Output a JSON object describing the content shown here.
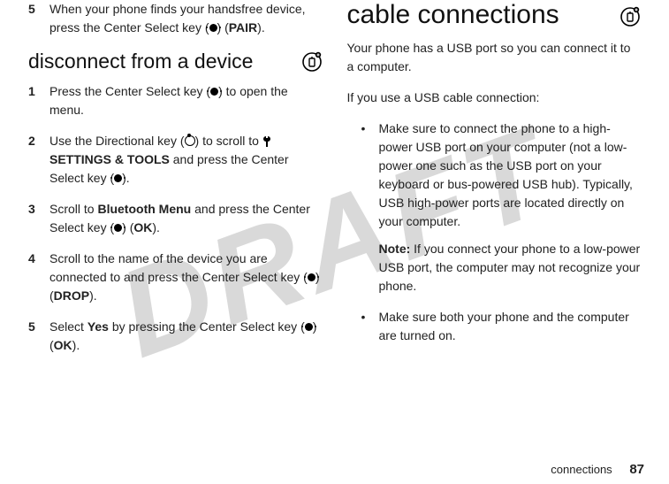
{
  "watermark": "DRAFT",
  "left": {
    "step5": {
      "num": "5",
      "text_a": "When your phone finds your handsfree device, press the Center Select key (",
      "text_b": ") (",
      "pair": "PAIR",
      "text_c": ")."
    },
    "h2": "disconnect from a device",
    "d1": {
      "num": "1",
      "a": "Press the Center Select key (",
      "b": ") to open the menu."
    },
    "d2": {
      "num": "2",
      "a": "Use the Directional key (",
      "b": ") to scroll to ",
      "menu": "SETTINGS & TOOLS",
      "c": " and press the Center Select key (",
      "d": ")."
    },
    "d3": {
      "num": "3",
      "a": "Scroll to ",
      "menu": "Bluetooth Menu",
      "b": " and press the Center Select key (",
      "c": ") (",
      "ok": "OK",
      "d": ")."
    },
    "d4": {
      "num": "4",
      "a": "Scroll to the name of the device you are connected to and press the Center Select key (",
      "b": ") (",
      "drop": "DROP",
      "c": ")."
    },
    "d5": {
      "num": "5",
      "a": "Select ",
      "yes": "Yes",
      "b": " by pressing the Center Select key (",
      "c": ") (",
      "ok": "OK",
      "d": ")."
    }
  },
  "right": {
    "h1": "cable connections",
    "p1": "Your phone has a USB port so you can connect it to a computer.",
    "p2": "If you use a USB cable connection:",
    "b1": "Make sure to connect the phone to a high-power USB port on your computer (not a low-power one such as the USB port on your keyboard or bus-powered USB hub). Typically, USB high-power ports are located directly on your computer.",
    "note_label": "Note:",
    "note_body": " If you connect your phone to a low-power USB port, the computer may not recognize your phone.",
    "b2": "Make sure both your phone and the computer are turned on."
  },
  "footer": {
    "section": "connections",
    "page": "87"
  }
}
